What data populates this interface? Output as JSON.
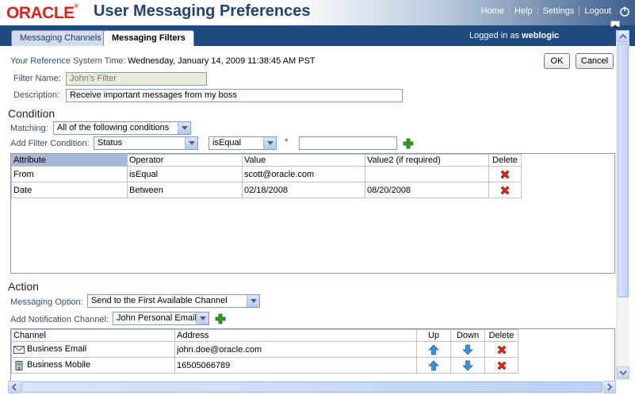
{
  "header": {
    "logo": "ORACLE",
    "title": "User Messaging Preferences",
    "nav": [
      "Home",
      "Help",
      "Settings",
      "Logout"
    ]
  },
  "tabs": {
    "channels": "Messaging Channels",
    "filters": "Messaging Filters"
  },
  "user": {
    "logged_prefix": "Logged in as",
    "username": "weblogic"
  },
  "form": {
    "ref_time_label": "Your Reference System Time:",
    "ref_time_value": "Wednesday, January 14, 2009 11:38:45 AM PST",
    "ok_label": "OK",
    "cancel_label": "Cancel",
    "filter_name_label": "Filter Name:",
    "filter_name_placeholder": "John's Filter",
    "description_label": "Description:",
    "description_value": "Receive important messages from my boss"
  },
  "condition": {
    "heading": "Condition",
    "matching_label": "Matching:",
    "matching_value": "All of the following conditions",
    "add_label": "Add Filter Condition:",
    "attribute_value": "Status",
    "operator_value": "isEqual",
    "required_mark": "*",
    "value_input": "",
    "columns": [
      "Attribute",
      "Operator",
      "Value",
      "Value2 (if required)",
      "Delete"
    ],
    "rows": [
      {
        "attribute": "From",
        "operator": "isEqual",
        "value": "scott@oracle.com",
        "value2": ""
      },
      {
        "attribute": "Date",
        "operator": "Between",
        "value": "02/18/2008",
        "value2": "08/20/2008"
      }
    ]
  },
  "action": {
    "heading": "Action",
    "option_label": "Messaging Option:",
    "option_value": "Send to the First Available Channel",
    "add_label": "Add Notification Channel:",
    "channel_value": "John Personal Email",
    "columns": [
      "Channel",
      "Address",
      "Up",
      "Down",
      "Delete"
    ],
    "rows": [
      {
        "channel": "Business Email",
        "address": "john.doe@oracle.com",
        "icon": "mail-icon"
      },
      {
        "channel": "Business Mobile",
        "address": "16505066789",
        "icon": "mobile-icon"
      }
    ]
  },
  "colors": {
    "header_blue": "#1f4a80",
    "oracle_red": "#e0201b",
    "title_blue": "#21427a",
    "delete_red": "#d9271c",
    "add_green": "#2e9c1f",
    "arrow_blue": "#2f7fd9"
  }
}
